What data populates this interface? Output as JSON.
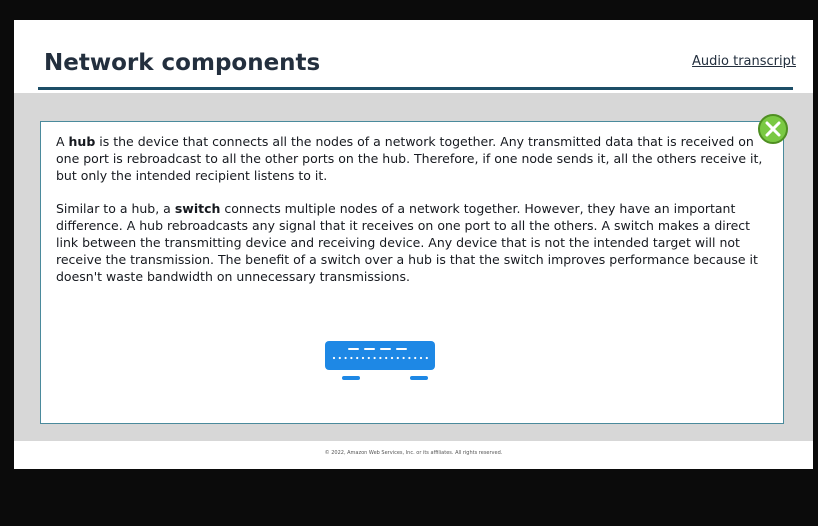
{
  "header": {
    "title": "Network components",
    "transcript_link": "Audio transcript"
  },
  "content": {
    "p1_before": "A ",
    "p1_term": "hub",
    "p1_after": " is the device that connects all the nodes of a network together. Any transmitted data that is received on one port is rebroadcast to all the other ports on the hub. Therefore, if one node sends it, all the others receive it, but only the intended recipient listens to it.",
    "p2_before": "Similar to a hub, a ",
    "p2_term": "switch",
    "p2_after": " connects multiple nodes of a network together. However, they have an important difference. A hub rebroadcasts any signal that it receives on one port to all the others. A switch makes a direct link between the transmitting device and receiving device. Any device that is not the intended target will not receive the transmission. The benefit of a switch over a hub is that the switch improves performance because it doesn't waste bandwidth on unnecessary transmissions."
  },
  "illustration": {
    "icon": "network-switch-icon",
    "color": "#1e88e5"
  },
  "close_button": {
    "icon": "close-icon",
    "color": "#7ac943"
  },
  "footer": {
    "copyright": "© 2022, Amazon Web Services, Inc. or its affiliates. All rights reserved."
  }
}
